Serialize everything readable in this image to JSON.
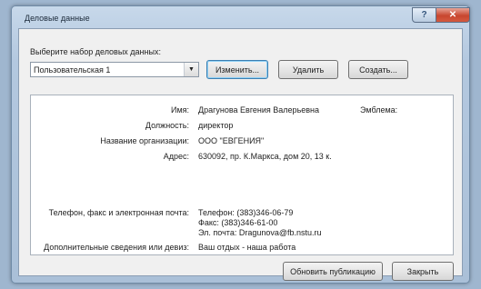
{
  "window": {
    "title": "Деловые данные"
  },
  "controls": {
    "select_label": "Выберите набор деловых данных:",
    "selected_set": "Пользовательская 1",
    "edit_button": "Изменить...",
    "delete_button": "Удалить",
    "create_button": "Создать..."
  },
  "card": {
    "name_label": "Имя:",
    "name_value": "Драгунова Евгения Валерьевна",
    "emblem_label": "Эмблема:",
    "position_label": "Должность:",
    "position_value": "директор",
    "org_label": "Название организации:",
    "org_value": "ООО \"ЕВГЕНИЯ\"",
    "address_label": "Адрес:",
    "address_value": "630092, пр. К.Маркса, дом 20, 13 к.",
    "contacts_label": "Телефон, факс и электронная почта:",
    "phone": "Телефон: (383)346-06-79",
    "fax": "Факс: (383)346-61-00",
    "email": "Эл. почта: Dragunova@fb.nstu.ru",
    "extra_label": "Дополнительные сведения или девиз:",
    "extra_value": "Ваш отдых - наша работа"
  },
  "footer": {
    "update_button": "Обновить публикацию",
    "close_button": "Закрыть"
  },
  "icons": {
    "help": "help-icon",
    "close": "close-icon",
    "dropdown": "chevron-down-icon"
  },
  "colors": {
    "accent": "#3c7fb1",
    "close_red": "#c8462f"
  }
}
